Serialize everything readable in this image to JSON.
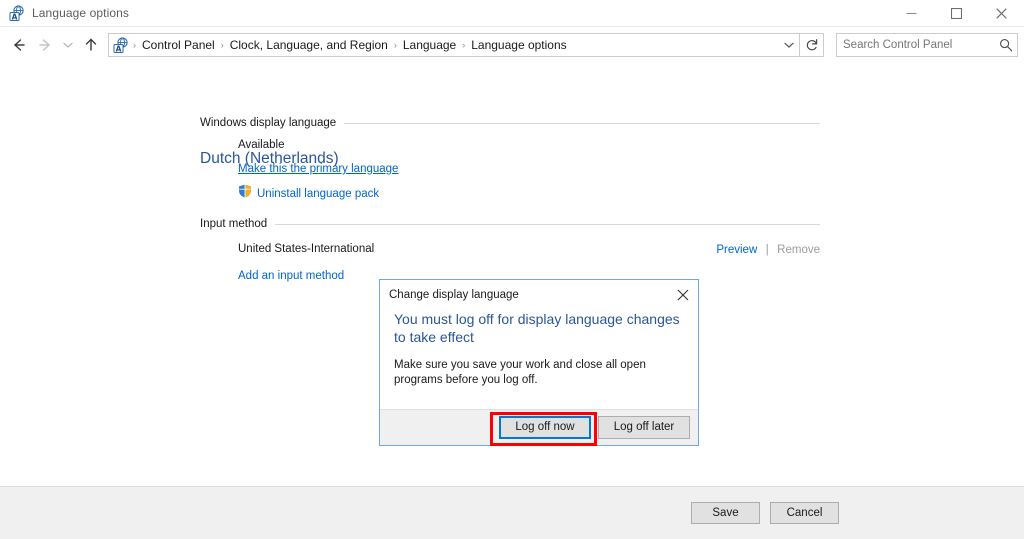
{
  "window": {
    "title": "Language options",
    "icon": "language-options-icon",
    "buttons": {
      "minimize": "minimize-icon",
      "maximize": "maximize-icon",
      "close": "close-icon"
    }
  },
  "navbar": {
    "back": "back-arrow-icon",
    "forward": "forward-arrow-icon",
    "recent": "chevron-down-icon",
    "up": "up-arrow-icon",
    "address_icon": "language-options-icon",
    "breadcrumbs": [
      "Control Panel",
      "Clock, Language, and Region",
      "Language",
      "Language options"
    ],
    "breadcrumb_separator": "›",
    "dropdown": "chevron-down-icon",
    "refresh": "refresh-icon"
  },
  "search": {
    "placeholder": "Search Control Panel",
    "value": "",
    "icon": "search-icon"
  },
  "main": {
    "page_title": "Dutch (Netherlands)",
    "groups": [
      {
        "label": "Windows display language",
        "status": "Available",
        "primary_link": "Make this the primary language",
        "uninstall_link": "Uninstall language pack",
        "uninstall_icon": "uac-shield-icon"
      },
      {
        "label": "Input method",
        "item": "United States-International",
        "preview_link": "Preview",
        "separator": "|",
        "remove_link": "Remove",
        "add_link": "Add an input method"
      }
    ]
  },
  "footer": {
    "save_label": "Save",
    "cancel_label": "Cancel"
  },
  "dialog": {
    "title": "Change display language",
    "close_icon": "close-icon",
    "heading": "You must log off for display language changes to take effect",
    "body": "Make sure you save your work and close all open programs before you log off.",
    "primary_button": "Log off now",
    "secondary_button": "Log off later"
  },
  "annotation": {
    "color": "#ff0000",
    "target": "Log off now"
  },
  "colors": {
    "accent_blue": "#2a5699",
    "link_blue": "#0066cc",
    "focus_blue": "#0078d7",
    "dialog_border": "#6fa8dc",
    "annotation_red": "#ff0000",
    "chrome_gray": "#f0f0f0",
    "disabled_gray": "#9c9c9c"
  }
}
